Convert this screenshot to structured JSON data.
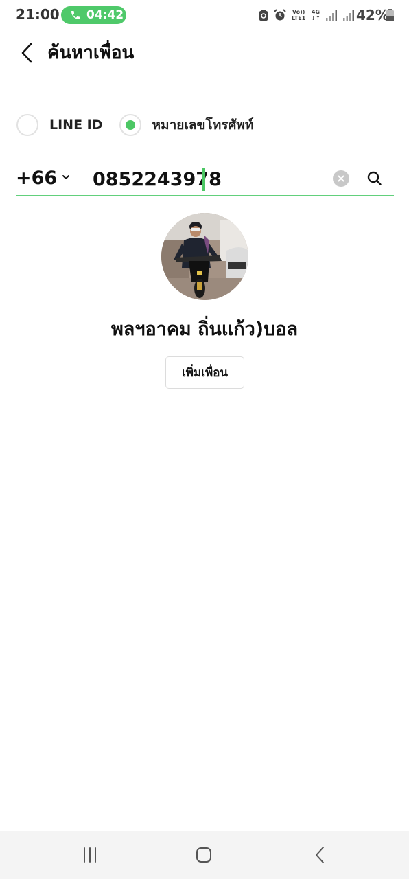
{
  "status_bar": {
    "time": "21:00",
    "call_timer": "04:42",
    "volte_label": "Vo))",
    "lte_label": "LTE1",
    "network_label": "4G",
    "battery": "42%",
    "icons": [
      "phone-icon",
      "sync-icon",
      "alarm-icon",
      "signal-icon",
      "battery-icon"
    ],
    "call_color": "#4fc96a"
  },
  "header": {
    "title": "ค้นหาเพื่อน",
    "back_icon": "chevron-left-icon"
  },
  "search_type": {
    "options": [
      {
        "label": "LINE ID",
        "selected": false
      },
      {
        "label": "หมายเลขโทรศัพท์",
        "selected": true
      }
    ],
    "accent": "#4cc764"
  },
  "search": {
    "country_code": "+66",
    "phone_value": "0852243978",
    "clear_icon": "clear-icon",
    "search_icon": "search-icon"
  },
  "result": {
    "name": "พลฯอาคม ถิ่นแก้ว)บอล",
    "add_button": "เพิ่มเพื่อน"
  },
  "nav_bar": {
    "icons": [
      "recent-apps-icon",
      "home-icon",
      "back-icon"
    ]
  }
}
